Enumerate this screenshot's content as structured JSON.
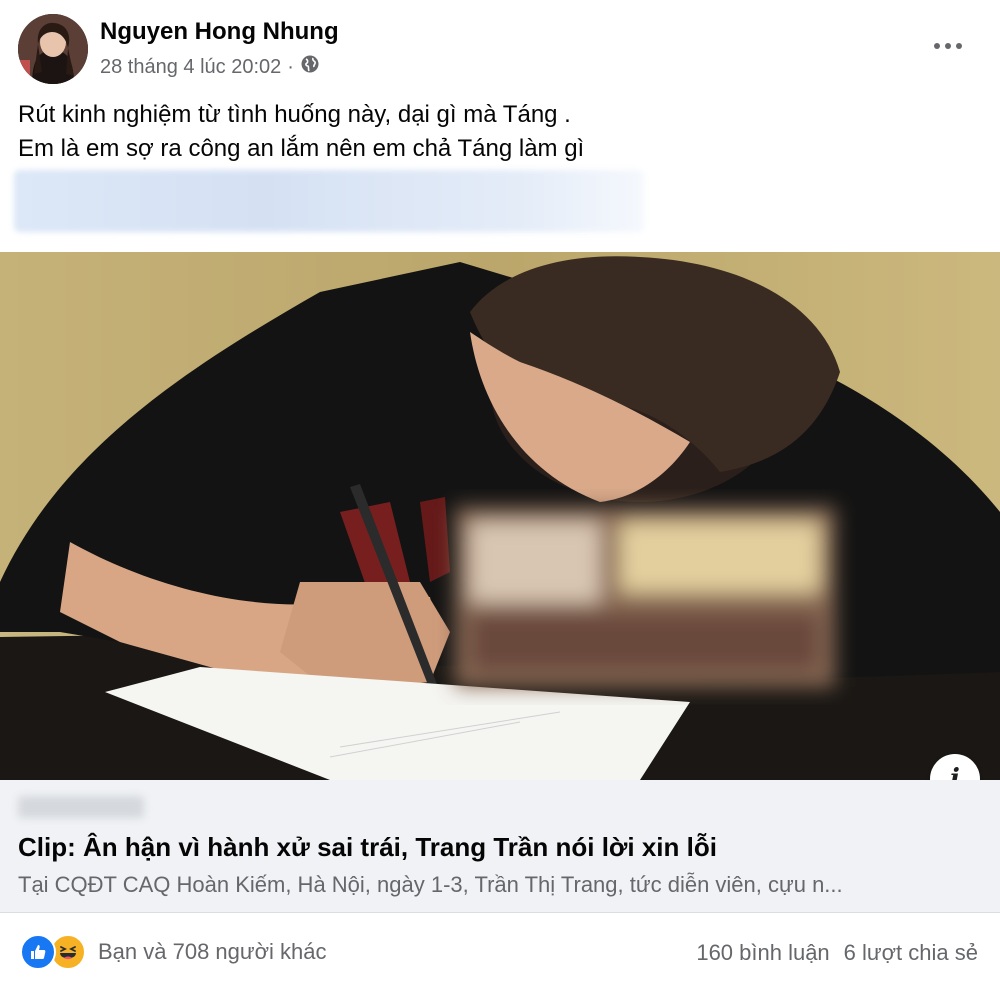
{
  "post": {
    "author": "Nguyen Hong Nhung",
    "timestamp": "28 tháng 4 lúc 20:02",
    "separator": "·",
    "privacy_icon": "globe-icon",
    "more_icon": "more-horizontal-icon",
    "text_line_1": "Rút kinh nghiệm từ tình huống này, dại gì mà Táng .",
    "text_line_2": "Em là em sợ ra công an lắm nên em chả Táng làm gì"
  },
  "link_preview": {
    "info_glyph": "i",
    "title": "Clip: Ân hận vì hành xử sai trái, Trang Trần nói lời xin lỗi",
    "description": "Tại CQĐT CAQ Hoàn Kiếm, Hà Nội, ngày 1-3, Trần Thị Trang, tức diễn viên, cựu n..."
  },
  "footer": {
    "reactions_text": "Bạn và 708 người khác",
    "comments": "160 bình luận",
    "shares": "6 lượt chia sẻ",
    "reaction_icons": [
      "like-icon",
      "haha-icon"
    ]
  },
  "colors": {
    "like_blue": "#1877f2",
    "haha_yellow": "#f7b125",
    "secondary_text": "#65676b",
    "link_bg": "#f0f2f5"
  }
}
